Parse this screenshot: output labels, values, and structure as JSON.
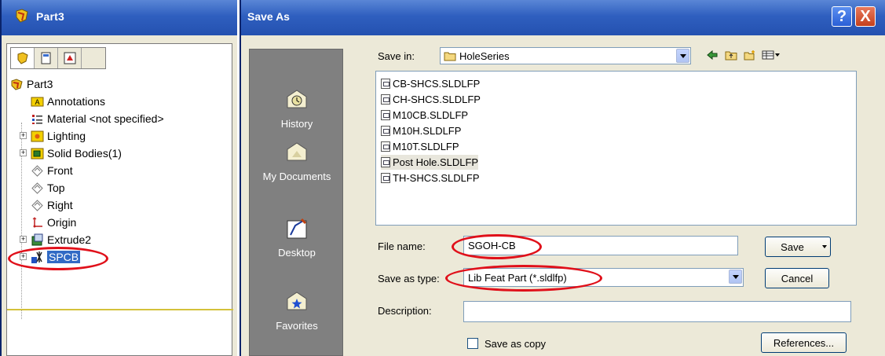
{
  "left_window": {
    "title": "Part3",
    "tree": {
      "root": "Part3",
      "items": [
        {
          "label": "Annotations",
          "icon": "annotations-icon"
        },
        {
          "label": "Material <not specified>",
          "icon": "material-icon"
        },
        {
          "label": "Lighting",
          "icon": "lighting-icon"
        },
        {
          "label": "Solid Bodies(1)",
          "icon": "solid-bodies-icon"
        },
        {
          "label": "Front",
          "icon": "plane-icon"
        },
        {
          "label": "Top",
          "icon": "plane-icon"
        },
        {
          "label": "Right",
          "icon": "plane-icon"
        },
        {
          "label": "Origin",
          "icon": "origin-icon"
        },
        {
          "label": "Extrude2",
          "icon": "extrude-icon"
        },
        {
          "label": "SPCB",
          "icon": "library-feature-icon"
        }
      ]
    }
  },
  "dialog": {
    "title": "Save As",
    "help_label": "?",
    "close_label": "X",
    "places": [
      "History",
      "My Documents",
      "Desktop",
      "Favorites"
    ],
    "save_in_label": "Save in:",
    "save_in_value": "HoleSeries",
    "files": [
      "CB-SHCS.SLDLFP",
      "CH-SHCS.SLDLFP",
      "M10CB.SLDLFP",
      "M10H.SLDLFP",
      "M10T.SLDLFP",
      "Post Hole.SLDLFP",
      "TH-SHCS.SLDLFP"
    ],
    "file_name_label": "File name:",
    "file_name_value": "SGOH-CB",
    "save_type_label": "Save as type:",
    "save_type_value": "Lib Feat Part (*.sldlfp)",
    "description_label": "Description:",
    "description_value": "",
    "save_as_copy_label": "Save as copy",
    "save_label": "Save",
    "cancel_label": "Cancel",
    "references_label": "References..."
  },
  "colors": {
    "title_bar": "#2f5fbf",
    "places_bar": "#808080",
    "dialog_bg": "#ece9d8",
    "annotation_red": "#e0101a",
    "selection": "#316ac5"
  }
}
